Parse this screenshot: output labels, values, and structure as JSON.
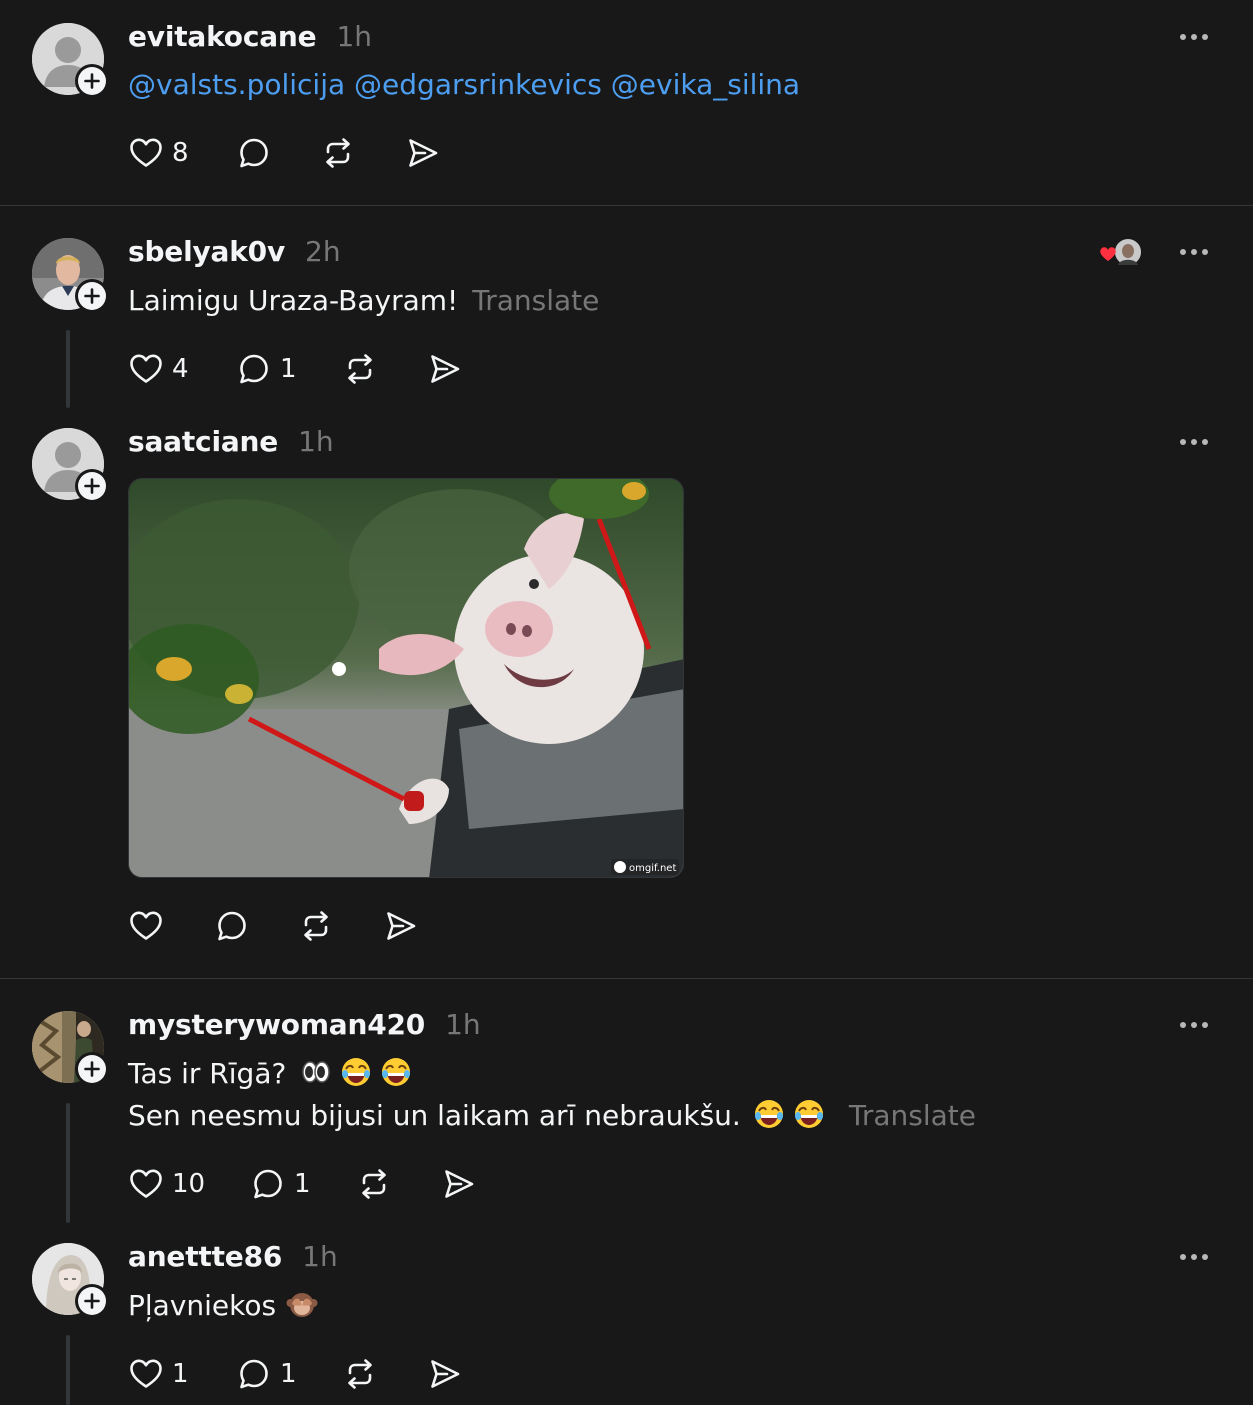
{
  "posts": [
    {
      "username": "evitakocane",
      "time": "1h",
      "mentions": [
        "@valsts.policija",
        "@edgarsrinkevics",
        "@evika_silina"
      ],
      "likes": "8"
    },
    {
      "username": "sbelyak0v",
      "time": "2h",
      "text": "Laimigu Uraza-Bayram!",
      "translate": "Translate",
      "likes": "4",
      "replies": "1"
    },
    {
      "username": "saatciane",
      "time": "1h",
      "media_watermark": "omgif.net"
    },
    {
      "username": "mysterywoman420",
      "time": "1h",
      "line1": "Tas ir Rīgā?",
      "line2": "Sen neesmu bijusi un laikam arī nebraukšu.",
      "translate": "Translate",
      "likes": "10",
      "replies": "1"
    },
    {
      "username": "anettte86",
      "time": "1h",
      "text": "Pļavniekos",
      "likes": "1",
      "replies": "1"
    }
  ],
  "icons": {
    "like": "heart-icon",
    "reply": "comment-icon",
    "repost": "repost-icon",
    "share": "send-icon",
    "more": "more-icon",
    "follow": "plus-icon"
  },
  "colors": {
    "background": "#181818",
    "text": "#f3f5f7",
    "muted": "#777777",
    "mention": "#4d9ef0",
    "divider": "#333638",
    "like_red": "#ff3040"
  }
}
